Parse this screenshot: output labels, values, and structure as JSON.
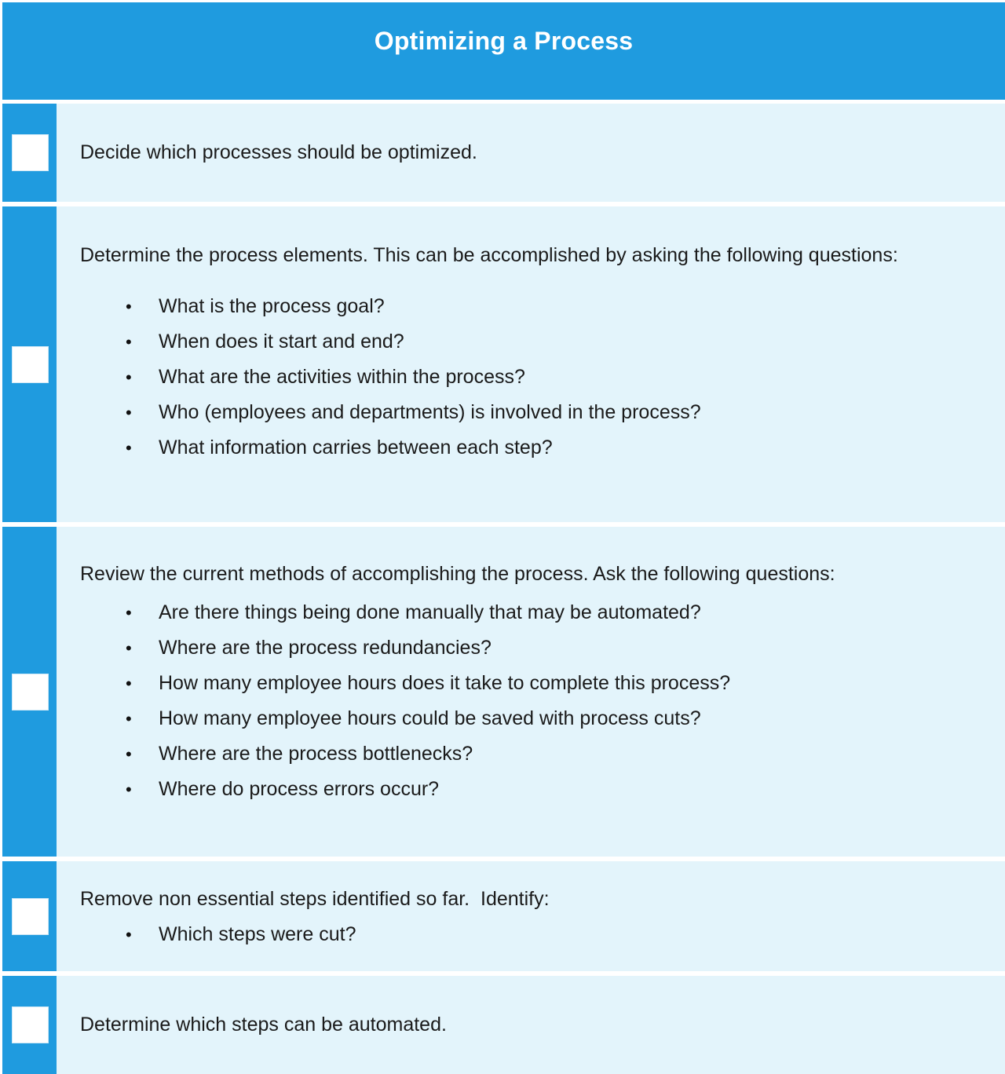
{
  "header": {
    "title": "Optimizing a Process",
    "background_color": "#1f9bdf",
    "text_color": "#ffffff"
  },
  "colors": {
    "accent_blue": "#1f9bdf",
    "row_background": "#e3f4fb",
    "page_background": "#ffffff",
    "checkbox_fill": "#ffffff",
    "text": "#1a1a1a"
  },
  "checklist": {
    "rows": [
      {
        "checkbox_state": "unchecked",
        "text": "Decide which processes should be optimized.",
        "bullets": []
      },
      {
        "checkbox_state": "unchecked",
        "text": "Determine the process elements. This can be accomplished by asking the following questions:",
        "bullets": [
          "What is the process goal?",
          "When does it start and end?",
          "What are the activities within the process?",
          "Who (employees and departments) is involved in the process?",
          "What information carries between each step?"
        ]
      },
      {
        "checkbox_state": "unchecked",
        "text": "Review the current methods of accomplishing the process. Ask the following questions:",
        "bullets": [
          "Are there things being done manually that may be automated?",
          "Where are the process redundancies?",
          "How many employee hours does it take to complete this process?",
          "How many employee hours could be saved with process cuts?",
          "Where are the process bottlenecks?",
          "Where do process errors occur?"
        ]
      },
      {
        "checkbox_state": "unchecked",
        "text": "Remove non essential steps identified so far.  Identify:",
        "bullets": [
          "Which steps were cut?"
        ]
      },
      {
        "checkbox_state": "unchecked",
        "text": "Determine which steps can be automated.",
        "bullets": []
      }
    ]
  }
}
